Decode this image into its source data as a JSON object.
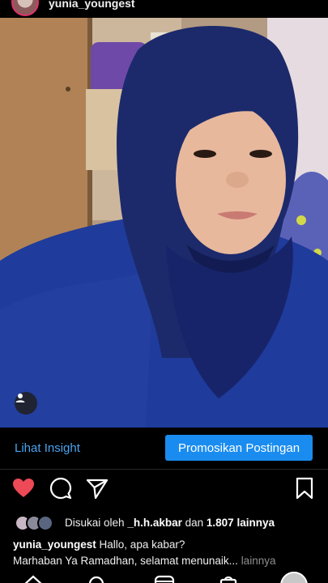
{
  "header": {
    "username": "yunia_youngest"
  },
  "post": {
    "photo_description_icon": "user-tag-icon",
    "insight_label": "Lihat Insight",
    "promote_label": "Promosikan Postingan",
    "liked": true,
    "likes": {
      "prefix": "Disukai oleh",
      "user": "_h.h.akbar",
      "joiner": "dan",
      "count": "1.807 lainnya"
    },
    "caption": {
      "user": "yunia_youngest",
      "line1": "Hallo, apa kabar?",
      "line2": "Marhaban Ya Ramadhan, selamat menunaik...",
      "more": "lainnya"
    }
  },
  "icons": {
    "like": "heart-icon",
    "comment": "comment-icon",
    "share": "send-icon",
    "save": "bookmark-icon"
  },
  "colors": {
    "accent_blue": "#1a8cf0",
    "link_blue": "#4aa3f0",
    "like_red": "#ed4956",
    "background": "#000000"
  }
}
